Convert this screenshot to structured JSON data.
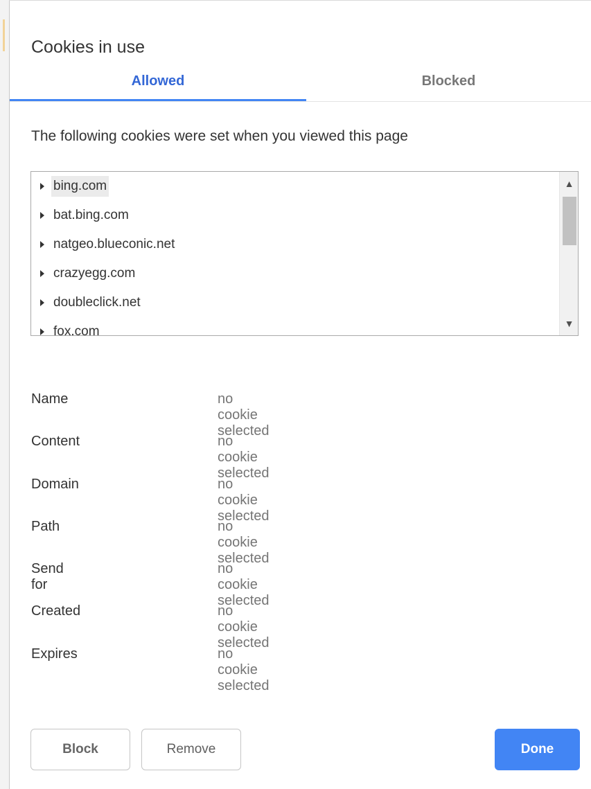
{
  "dialog": {
    "title": "Cookies in use"
  },
  "tabs": [
    {
      "label": "Allowed",
      "selected": true
    },
    {
      "label": "Blocked",
      "selected": false
    }
  ],
  "description": "The following cookies were set when you viewed this page",
  "cookies": [
    {
      "label": "bing.com",
      "highlighted": true
    },
    {
      "label": "bat.bing.com"
    },
    {
      "label": "natgeo.blueconic.net"
    },
    {
      "label": "crazyegg.com"
    },
    {
      "label": "doubleclick.net"
    },
    {
      "label": "fox.com"
    }
  ],
  "details": [
    {
      "label": "Name",
      "value": "no cookie selected"
    },
    {
      "label": "Content",
      "value": "no cookie selected"
    },
    {
      "label": "Domain",
      "value": "no cookie selected"
    },
    {
      "label": "Path",
      "value": "no cookie selected"
    },
    {
      "label": "Send for",
      "value": "no cookie selected"
    },
    {
      "label": "Created",
      "value": "no cookie selected"
    },
    {
      "label": "Expires",
      "value": "no cookie selected"
    }
  ],
  "buttons": {
    "block": "Block",
    "remove": "Remove",
    "done": "Done"
  },
  "icons": {
    "scroll_up": "▲",
    "scroll_down": "▼"
  },
  "colors": {
    "accent": "#4285f4",
    "selected_tab_text": "#3367d6"
  }
}
